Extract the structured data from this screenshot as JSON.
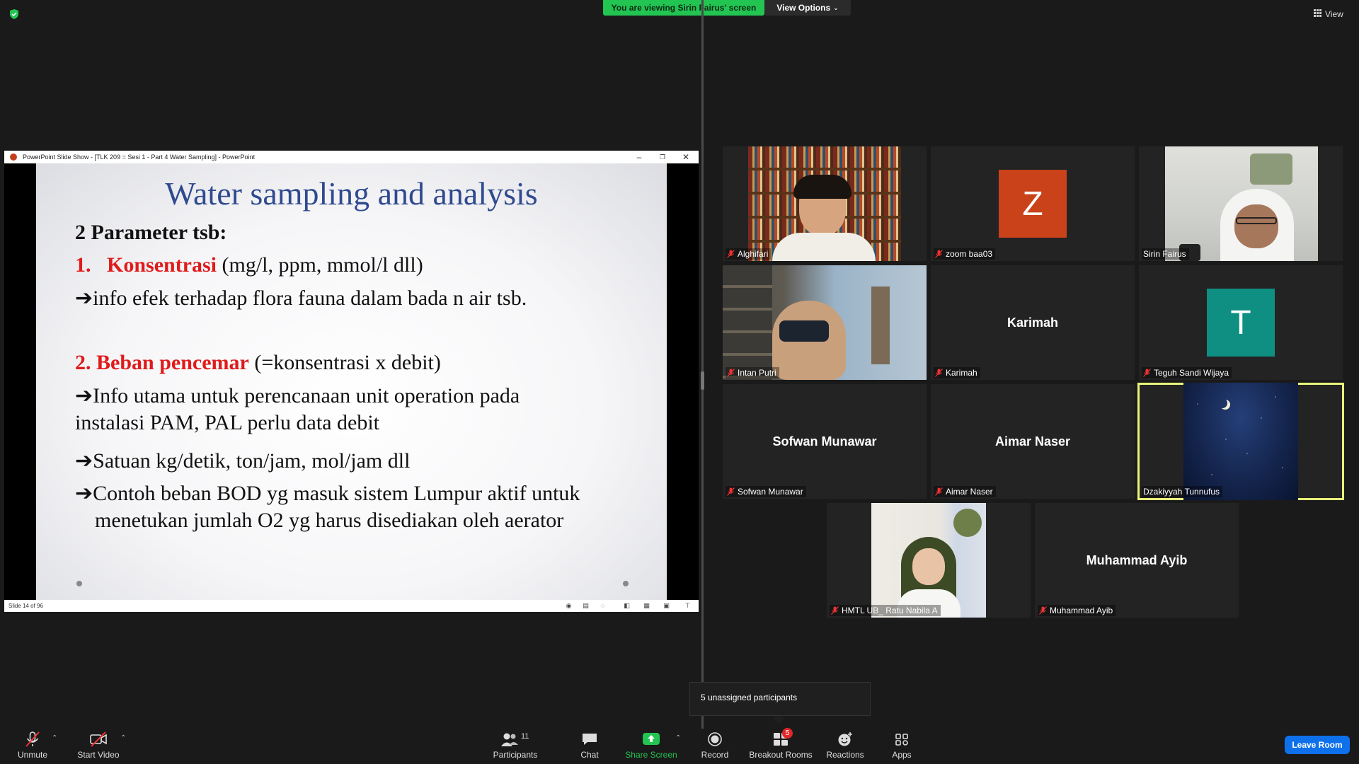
{
  "banner": {
    "viewing_text": "You are viewing Sirin Fairus' screen",
    "view_options_label": "View Options",
    "view_label": "View"
  },
  "ppt": {
    "window_title": "PowerPoint Slide Show - [TLK 209 = Sesi 1 - Part 4 Water Sampling] - PowerPoint",
    "status": "Slide 14 of 96",
    "slide": {
      "title": "Water sampling and analysis",
      "line1": "2 Parameter tsb:",
      "item1_num": "1.",
      "item1_key": "Konsentrasi",
      "item1_rest": "(mg/l, ppm, mmol/l  dll)",
      "item1_info": "info efek terhadap flora fauna dalam bada n air tsb.",
      "item2_key": "2. Beban pencemar",
      "item2_rest": "(=konsentrasi  x debit)",
      "bullet1a": "Info utama untuk perencanaan unit operation pada",
      "bullet1b": "instalasi  PAM, PAL perlu data  debit",
      "bullet2": "Satuan kg/detik, ton/jam, mol/jam dll",
      "bullet3a": "Contoh beban BOD yg masuk sistem Lumpur aktif untuk",
      "bullet3b": "menetukan jumlah O2 yg harus disediakan oleh aerator",
      "arrow": "➔"
    }
  },
  "participants": [
    {
      "name": "Alghifari",
      "type": "video"
    },
    {
      "name": "zoom baa03",
      "type": "avatar",
      "letter": "Z",
      "color": "#c9421a"
    },
    {
      "name": "Sirin Fairus",
      "type": "video"
    },
    {
      "name": "Intan Putri",
      "type": "video"
    },
    {
      "name": "Karimah",
      "type": "name",
      "display": "Karimah"
    },
    {
      "name": "Teguh Sandi Wijaya",
      "type": "avatar",
      "letter": "T",
      "color": "#0e8f82"
    },
    {
      "name": "Sofwan Munawar",
      "type": "name",
      "display": "Sofwan Munawar"
    },
    {
      "name": "Aimar Naser",
      "type": "name",
      "display": "Aimar Naser"
    },
    {
      "name": "Dzakiyyah Tunnufus",
      "type": "video"
    },
    {
      "name": "HMTL UB_ Ratu Nabila A",
      "type": "video"
    },
    {
      "name": "Muhammad Ayib",
      "type": "name",
      "display": "Muhammad Ayib"
    }
  ],
  "tooltip": {
    "text": "5 unassigned participants"
  },
  "toolbar": {
    "unmute": "Unmute",
    "start_video": "Start Video",
    "participants": "Participants",
    "participants_count": "11",
    "chat": "Chat",
    "share_screen": "Share Screen",
    "record": "Record",
    "breakout_rooms": "Breakout Rooms",
    "breakout_badge": "5",
    "reactions": "Reactions",
    "apps": "Apps",
    "leave_room": "Leave Room"
  },
  "colors": {
    "share_green": "#23c552",
    "leave_blue": "#0e71eb",
    "active_speaker": "#e8f57a",
    "slide_title_blue": "#2f4a8f",
    "slide_red": "#e01b1b"
  }
}
